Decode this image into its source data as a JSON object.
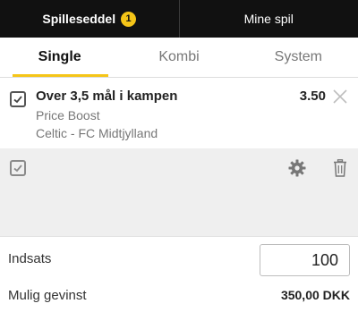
{
  "header": {
    "tabs": [
      {
        "label": "Spilleseddel",
        "badge": "1",
        "active": true
      },
      {
        "label": "Mine spil",
        "active": false
      }
    ]
  },
  "bet_types": [
    {
      "label": "Single",
      "active": true
    },
    {
      "label": "Kombi",
      "active": false
    },
    {
      "label": "System",
      "active": false
    }
  ],
  "bet": {
    "selection": "Over 3,5 mål i kampen",
    "market": "Price Boost",
    "match": "Celtic - FC Midtjylland",
    "odds": "3.50",
    "checked": true
  },
  "options": {
    "checked": true,
    "icons": [
      "checkbox-icon",
      "gear-icon",
      "trash-icon"
    ]
  },
  "stake": {
    "label": "Indsats",
    "value": "100"
  },
  "potential_win": {
    "label": "Mulig gevinst",
    "value": "350,00 DKK"
  },
  "colors": {
    "accent": "#f5c518",
    "header_bg": "#111111",
    "options_bg": "#efefef"
  }
}
